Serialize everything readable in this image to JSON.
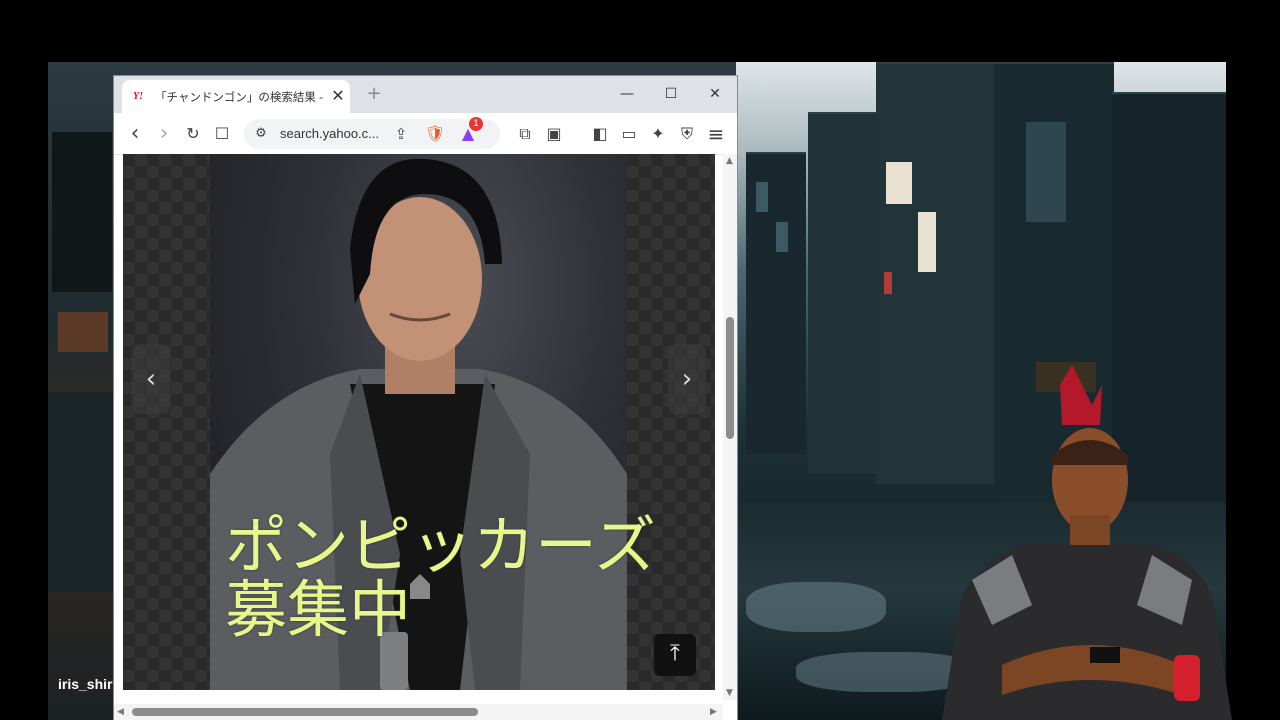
{
  "stream": {
    "username": "iris_shir"
  },
  "browser": {
    "tab": {
      "favicon": "Y!",
      "title": "「チャンドンゴン」の検索結果 - Yahoo",
      "close": "✕"
    },
    "new_tab": "+",
    "window_controls": {
      "minimize": "—",
      "maximize": "☐",
      "close": "✕"
    },
    "toolbar": {
      "back": "‹",
      "forward": "›",
      "reload": "↻",
      "bookmark": "☐",
      "site_info": "⚙",
      "url": "search.yahoo.c...",
      "share": "⇪",
      "brave_shield": "🛡",
      "rewards_badge": "1",
      "extensions": "⧉",
      "reader": "▣",
      "sidebar": "◧",
      "wallet": "▭",
      "leo": "✦",
      "vpn": "⛨",
      "menu": "≡"
    },
    "viewer": {
      "prev": "‹",
      "next": "›",
      "overlay_line1": "ポンピッカーズ",
      "overlay_line2": "募集中",
      "back_to_top": "⤒"
    }
  },
  "colors": {
    "overlay_text": "#e8f78a",
    "tab_bar": "#dee1e6",
    "brave_orange": "#f05a24"
  }
}
